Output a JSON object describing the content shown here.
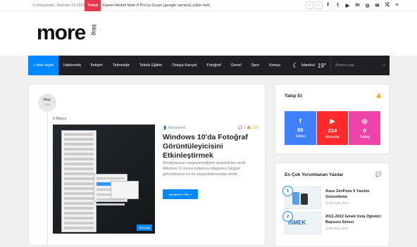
{
  "topbar": {
    "date": "◷ Perşembe, Haziran 24 2021",
    "trend_label": "Trend",
    "ticker": "Xiaomi Redmi Note 8 Pro'ya Gcam (google camera) yükle mek",
    "prev_arrow": "‹",
    "next_arrow": "›",
    "socials": [
      "f",
      "t",
      "▶",
      "in",
      "◎",
      "✉",
      "⤭",
      "≡"
    ]
  },
  "logo": {
    "main": "more",
    "sub": "blog"
  },
  "nav": {
    "items": [
      {
        "label": "⌂ Ana sayfa",
        "active": true
      },
      {
        "label": "Hakkımda"
      },
      {
        "label": "İletişim"
      },
      {
        "label": "Teknoloji",
        "dropdown": true
      },
      {
        "label": "Teknik Eğitim"
      },
      {
        "label": "Ortaya Karışık"
      },
      {
        "label": "Fotoğraf"
      },
      {
        "label": "Genel"
      },
      {
        "label": "Spor"
      },
      {
        "label": "Konya"
      }
    ],
    "weather_city": "İstanbul",
    "weather_temp": "19°",
    "search_placeholder": "Arama yap ..."
  },
  "post": {
    "month": "May",
    "year": "2020",
    "day": "9 Mayıs",
    "author": "👤 Muhammet",
    "comments": "💬 0",
    "views": "🔥 725",
    "title": "Windows 10'da Fotoğraf Görüntüleyicisini Etkinleştirmek",
    "excerpt": "Birçoğumuzun vazgeçemediğimiz alışkanlıkları vardır. Windows 10 öncesi kullanmış olduğumuz fotoğraf görüntüleyicisi ise bu alışkanlıklarımızdan biridir…",
    "readmore": "Devamını Oku »",
    "thumb_badge": "Teknoloji"
  },
  "follow": {
    "title": "Takip Et",
    "boxes": [
      {
        "icon": "f",
        "count": "88",
        "label": "Takipçi"
      },
      {
        "icon": "▶",
        "count": "214",
        "label": "Abonelar"
      },
      {
        "icon": "◎",
        "count": "0",
        "label": "Takipçi"
      }
    ]
  },
  "popular": {
    "title": "En Çok Yorumlanan Yazılar",
    "items": [
      {
        "num": "1",
        "title": "Asus ZenFone 5 Yazılım Güncelleme",
        "date": "◷ 30 Eylül 2014"
      },
      {
        "num": "2",
        "title": "2011-2012 İsmek Usta Öğretici Başvuru Süreci",
        "date": "◷ 09 Ekim 2011",
        "img_text": "İSMEK"
      }
    ]
  }
}
